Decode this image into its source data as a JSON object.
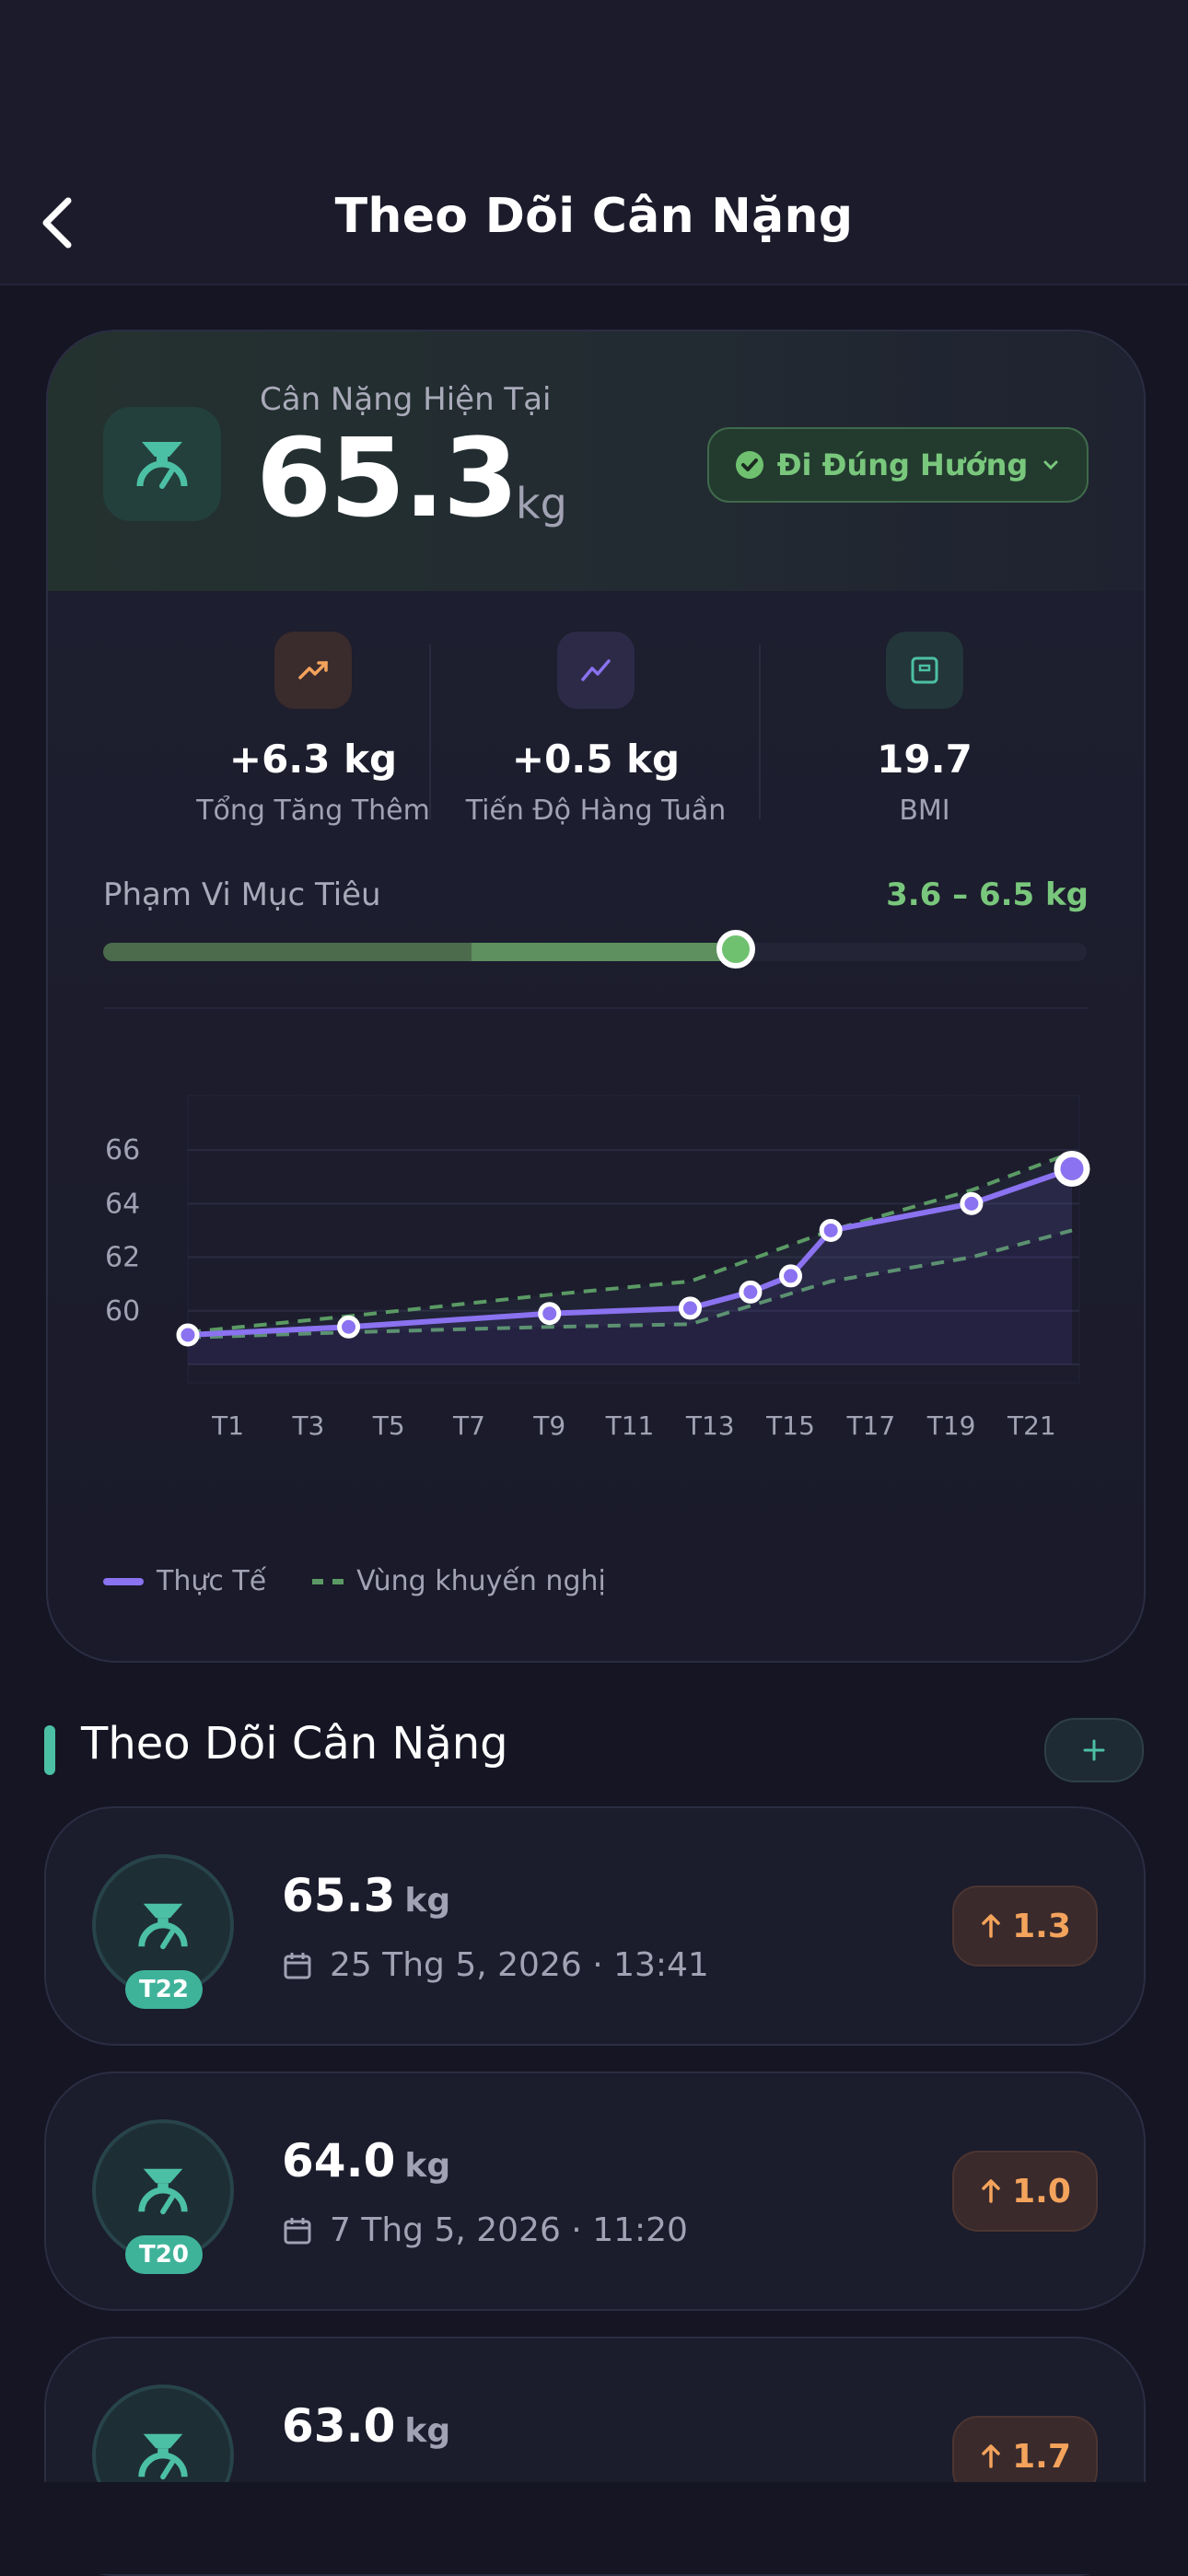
{
  "header": {
    "title": "Theo Dõi Cân Nặng"
  },
  "summary": {
    "current_label": "Cân Nặng Hiện Tại",
    "current_value": "65.3",
    "unit": "kg",
    "status": "Đi Đúng Hướng"
  },
  "stats": [
    {
      "value": "+6.3 kg",
      "label": "Tổng Tăng Thêm",
      "color": "#f4a35c"
    },
    {
      "value": "+0.5 kg",
      "label": "Tiến Độ Hàng Tuần",
      "color": "#8a72f0"
    },
    {
      "value": "19.7",
      "label": "BMI",
      "color": "#4cc0a4"
    }
  ],
  "target": {
    "label": "Phạm Vi Mục Tiêu",
    "value": "3.6 – 6.5 kg",
    "progress": 0.66
  },
  "chart_data": {
    "type": "line",
    "x": [
      1,
      5,
      10,
      13.5,
      15,
      16,
      17,
      20.5,
      23
    ],
    "series": [
      {
        "name": "Thực Tế",
        "values": [
          59.1,
          59.4,
          59.9,
          60.1,
          60.7,
          61.3,
          63.0,
          64.0,
          65.3
        ]
      }
    ],
    "band": {
      "name": "Vùng khuyến nghị",
      "x": [
        1,
        5,
        10,
        13.5,
        17,
        20.5,
        23
      ],
      "upper": [
        59.2,
        59.8,
        60.6,
        61.1,
        63.0,
        64.5,
        65.9
      ],
      "lower": [
        59.0,
        59.2,
        59.4,
        59.5,
        61.1,
        62.0,
        63.0
      ]
    },
    "x_ticks": [
      "T1",
      "T3",
      "T5",
      "T7",
      "T9",
      "T11",
      "T13",
      "T15",
      "T17",
      "T19",
      "T21"
    ],
    "x_tick_values": [
      2,
      4,
      6,
      8,
      10,
      12,
      14,
      16,
      18,
      20,
      22
    ],
    "y_ticks": [
      60,
      62,
      64,
      66
    ],
    "xlim": [
      1,
      23
    ],
    "ylim": [
      58,
      67
    ],
    "grid": true,
    "legend": "bottom-left",
    "colors": {
      "actual": "#8a72f0",
      "band": "#5b9a64"
    }
  },
  "log_section": {
    "title": "Theo Dõi Cân Nặng"
  },
  "entries": [
    {
      "week": "T22",
      "weight": "65.3",
      "unit": "kg",
      "date": "25 Thg 5, 2026 · 13:41",
      "delta": "1.3"
    },
    {
      "week": "T20",
      "weight": "64.0",
      "unit": "kg",
      "date": "7 Thg 5, 2026 · 11:20",
      "delta": "1.0"
    },
    {
      "week": "",
      "weight": "63.0",
      "unit": "kg",
      "date": "",
      "delta": "1.7"
    }
  ]
}
